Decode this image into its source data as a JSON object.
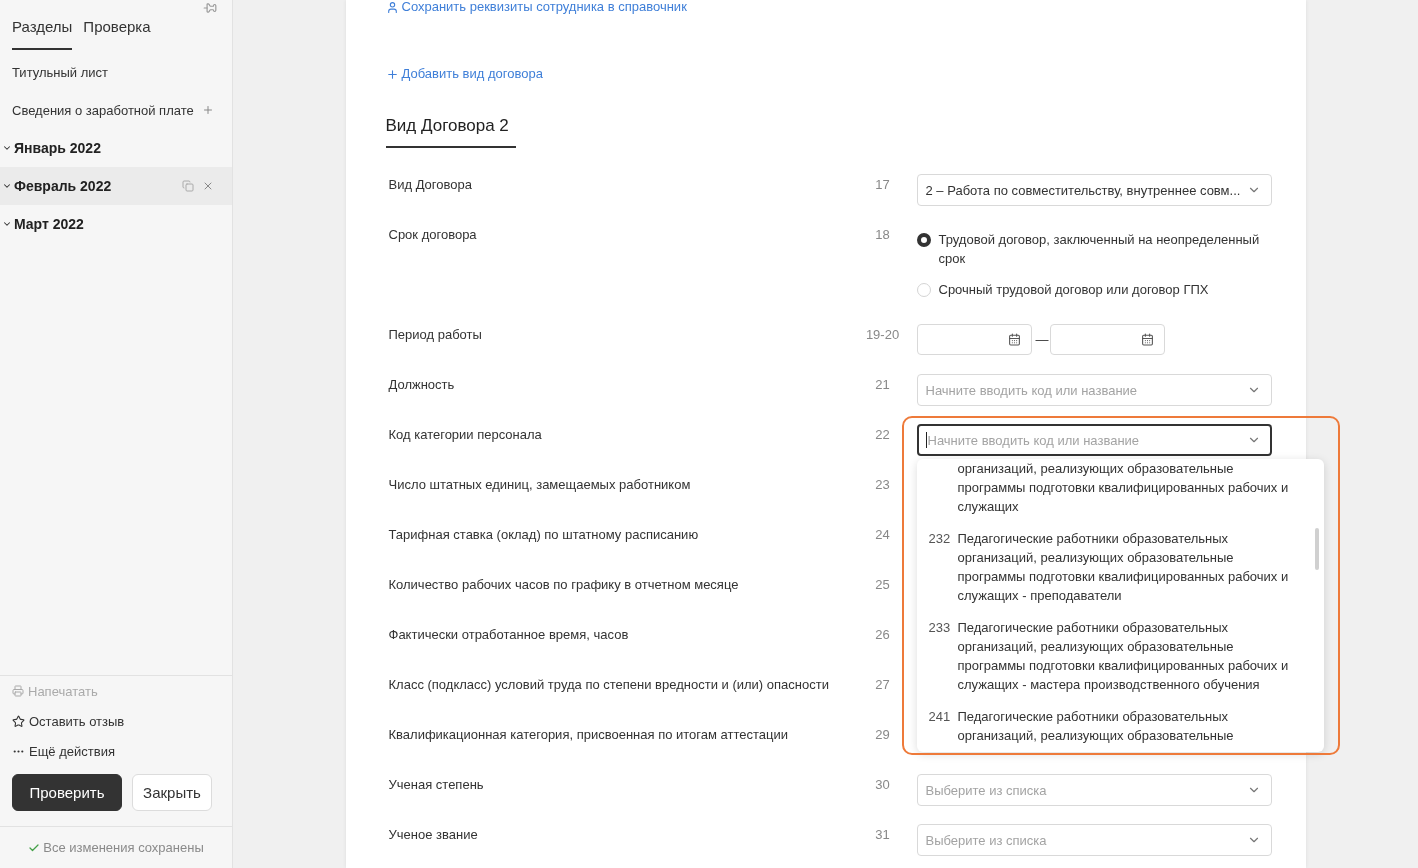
{
  "sidebar": {
    "tabs": [
      {
        "label": "Разделы",
        "selected": true
      },
      {
        "label": "Проверка",
        "selected": false
      }
    ],
    "items": [
      {
        "kind": "page",
        "label": "Титульный лист"
      },
      {
        "kind": "addable",
        "label": "Сведения о заработной плате"
      }
    ],
    "months": [
      {
        "label": "Январь 2022",
        "selected": false
      },
      {
        "label": "Февраль 2022",
        "selected": true
      },
      {
        "label": "Март 2022",
        "selected": false
      }
    ],
    "actions": [
      {
        "kind": "print",
        "label": "Напечатать",
        "disabled": true
      },
      {
        "kind": "feedback",
        "label": "Оставить отзыв",
        "disabled": false
      },
      {
        "kind": "more",
        "label": "Ещё действия",
        "disabled": false
      }
    ],
    "buttons": [
      {
        "kind": "primary",
        "label": "Проверить"
      },
      {
        "kind": "secondary",
        "label": "Закрыть"
      }
    ],
    "status": "Все изменения сохранены"
  },
  "form": {
    "top_link": "Сохранить реквизиты сотрудника в справочник",
    "add_link": "Добавить вид договора",
    "tabs": [
      {
        "label": "Вид Договора 2",
        "selected": true
      }
    ],
    "rows": [
      {
        "label": "Вид Договора",
        "number": "17",
        "control": {
          "kind": "select",
          "value": "2 – Работа по совместительству, внутреннее совм..."
        }
      },
      {
        "label": "Срок договора",
        "number": "18",
        "control": {
          "kind": "radio",
          "options": [
            {
              "label": "Трудовой договор, заключенный на неопределенный срок",
              "selected": true
            },
            {
              "label": "Срочный трудовой договор или договор ГПХ",
              "selected": false
            }
          ]
        }
      },
      {
        "label": "Период работы",
        "number": "19-20",
        "control": {
          "kind": "date_range",
          "separator": "—"
        }
      },
      {
        "label": "Должность",
        "number": "21",
        "control": {
          "kind": "combobox",
          "placeholder": "Начните вводить код или название",
          "focused": false
        }
      },
      {
        "label": "Код категории персонала",
        "number": "22",
        "highlighted": true,
        "control": {
          "kind": "combobox",
          "placeholder": "Начните вводить код или название",
          "focused": true,
          "options": [
            {
              "text": "организаций, реализующих образовательные программы подготовки квалифицированных рабочих и служащих"
            },
            {
              "code": "232",
              "text": "Педагогические работники образовательных организаций, реализующих образовательные программы подготовки квалифицированных рабочих и служащих - преподаватели"
            },
            {
              "code": "233",
              "text": "Педагогические работники образовательных организаций, реализующих образовательные программы подготовки квалифицированных рабочих и служащих - мастера производственного обучения"
            },
            {
              "code": "241",
              "text": "Педагогические работники образовательных организаций, реализующих образовательные"
            }
          ]
        }
      },
      {
        "label": "Число штатных единиц, замещаемых работником",
        "number": "23"
      },
      {
        "label": "Тарифная ставка (оклад) по штатному расписанию",
        "number": "24"
      },
      {
        "label": "Количество рабочих часов по графику в отчетном месяце",
        "number": "25"
      },
      {
        "label": "Фактически отработанное время, часов",
        "number": "26"
      },
      {
        "label": "Класс (подкласс) условий труда по степени вредности и (или) опасности",
        "number": "27"
      },
      {
        "label": "Квалификационная категория, присвоенная по итогам аттестации",
        "number": "29"
      },
      {
        "label": "Ученая степень",
        "number": "30",
        "control": {
          "kind": "select",
          "placeholder": "Выберите из списка"
        }
      },
      {
        "label": "Ученое звание",
        "number": "31",
        "control": {
          "kind": "select",
          "placeholder": "Выберите из списка"
        }
      }
    ]
  }
}
